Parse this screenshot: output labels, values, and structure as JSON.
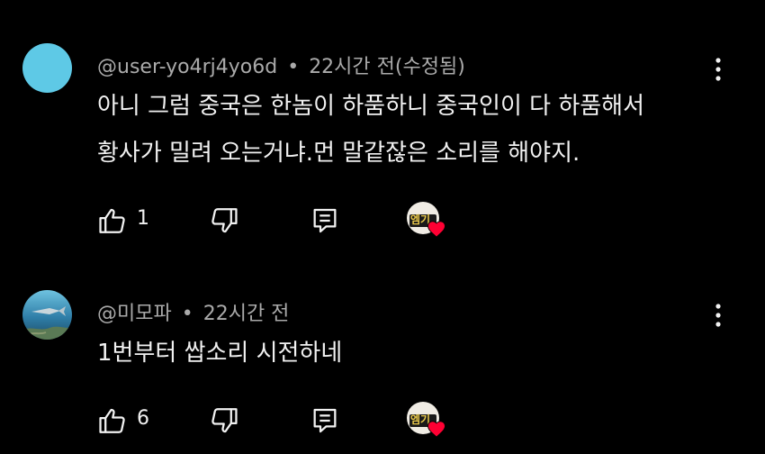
{
  "comments": [
    {
      "username": "@user-yo4rj4yo6d",
      "separator": "•",
      "time": "22시간 전(수정됨)",
      "lines": [
        "아니 그럼 중국은 한놈이 하품하니 중국인이 다 하품해서",
        "황사가 밀려 오는거냐.먼 말같잖은 소리를 해야지."
      ],
      "like_count": "1",
      "avatar_color": "#5ec9e6",
      "creator_badge": "엠기"
    },
    {
      "username": "@미모파",
      "separator": "•",
      "time": "22시간 전",
      "lines": [
        "1번부터 쌉소리 시전하네"
      ],
      "like_count": "6",
      "avatar_color": "#3a8fb0",
      "creator_badge": "엠기"
    }
  ],
  "icons": {
    "like": "thumbs-up-icon",
    "dislike": "thumbs-down-icon",
    "reply": "reply-icon",
    "menu": "more-vert-icon",
    "heart": "heart-icon"
  },
  "colors": {
    "background": "#000000",
    "text": "#f1f1f1",
    "meta": "#aaaaaa",
    "heart": "#ff0033"
  }
}
